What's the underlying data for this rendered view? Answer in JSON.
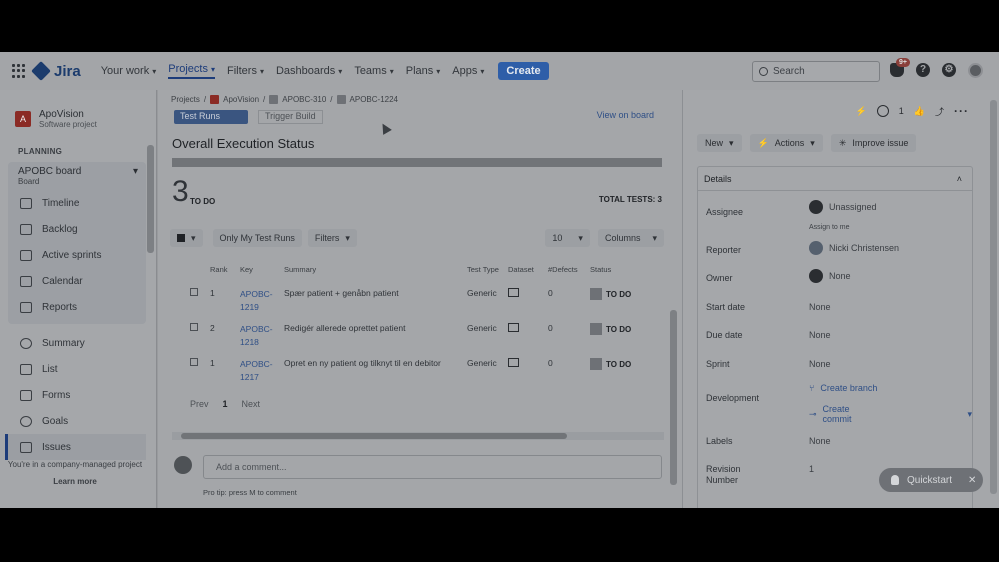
{
  "topbar": {
    "app_name": "Jira",
    "nav": [
      {
        "label": "Your work",
        "active": false
      },
      {
        "label": "Projects",
        "active": true
      },
      {
        "label": "Filters",
        "active": false
      },
      {
        "label": "Dashboards",
        "active": false
      },
      {
        "label": "Teams",
        "active": false
      },
      {
        "label": "Plans",
        "active": false
      },
      {
        "label": "Apps",
        "active": false
      }
    ],
    "create_label": "Create",
    "search_placeholder": "Search",
    "notification_count": "9+"
  },
  "sidebar": {
    "project_name": "ApoVision",
    "project_type": "Software project",
    "planning_header": "PLANNING",
    "board_name": "APOBC board",
    "board_sub": "Board",
    "board_items": [
      "Timeline",
      "Backlog",
      "Active sprints",
      "Calendar",
      "Reports"
    ],
    "other_items": [
      "Summary",
      "List",
      "Forms",
      "Goals",
      "Issues"
    ],
    "footer_text": "You're in a company-managed project",
    "learn_more": "Learn more"
  },
  "breadcrumb": {
    "projects": "Projects",
    "project": "ApoVision",
    "parent": "APOBC-310",
    "current": "APOBC-1224"
  },
  "main": {
    "ghost_btn_1": "Test Runs",
    "ghost_btn_2": "Trigger Build",
    "view_on_board": "View on board",
    "overall_title": "Overall Execution Status",
    "todo_count": "3",
    "todo_label": "TO DO",
    "total_tests": "TOTAL TESTS: 3",
    "only_my_runs": "Only My Test Runs",
    "filters": "Filters",
    "page_size": "10",
    "columns": "Columns",
    "headers": [
      "Rank",
      "Key",
      "Summary",
      "Test Type",
      "Dataset",
      "#Defects",
      "Status"
    ],
    "rows": [
      {
        "rank": "1",
        "key": "APOBC-1219",
        "summary": "Spær patient + genåbn patient",
        "type": "Generic",
        "defects": "0",
        "status": "TO DO"
      },
      {
        "rank": "2",
        "key": "APOBC-1218",
        "summary": "Redigér allerede oprettet patient",
        "type": "Generic",
        "defects": "0",
        "status": "TO DO"
      },
      {
        "rank": "1",
        "key": "APOBC-1217",
        "summary": "Opret en ny patient og tilknyt til en debitor",
        "type": "Generic",
        "defects": "0",
        "status": "TO DO"
      }
    ],
    "prev": "Prev",
    "page": "1",
    "next": "Next",
    "comment_placeholder": "Add a comment...",
    "pro_tip": "Pro tip: press  M  to comment"
  },
  "right": {
    "watch_count": "1",
    "status_btn": "New",
    "actions_btn": "Actions",
    "improve_btn": "Improve issue",
    "details_header": "Details",
    "fields": [
      {
        "label": "Assignee",
        "value": "Unassigned"
      },
      {
        "label": "Reporter",
        "value": "Nicki Christensen"
      },
      {
        "label": "Owner",
        "value": "None"
      },
      {
        "label": "Start date",
        "value": "None"
      },
      {
        "label": "Due date",
        "value": "None"
      },
      {
        "label": "Sprint",
        "value": "None"
      },
      {
        "label": "Development",
        "value": "Create branch"
      },
      {
        "label": "Labels",
        "value": "None"
      },
      {
        "label": "Revision Number",
        "value": "1"
      }
    ],
    "assign_to_me": "Assign to me",
    "create_commit": "Create commit"
  },
  "quickstart": {
    "label": "Quickstart"
  },
  "colors": {
    "accent": "#1d3c7a",
    "create": "#2e5ea8",
    "overlay_bg": "#999b9e"
  }
}
